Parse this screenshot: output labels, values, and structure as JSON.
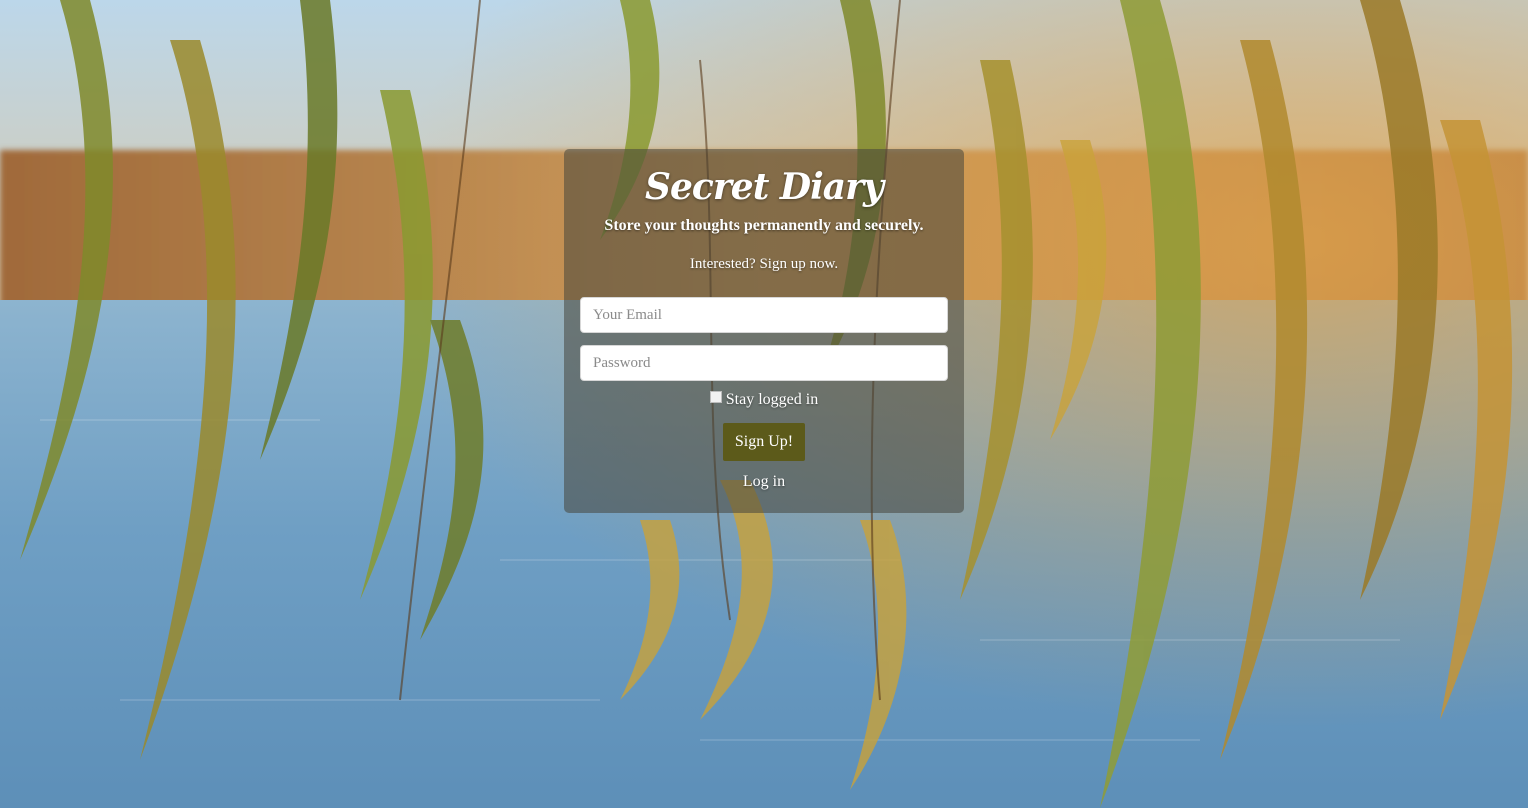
{
  "brand": {
    "title": "Secret Diary",
    "tagline": "Store your thoughts permanently and securely."
  },
  "form": {
    "prompt": "Interested? Sign up now.",
    "email_placeholder": "Your Email",
    "password_placeholder": "Password",
    "stay_logged_in_label": "Stay logged in",
    "stay_logged_in_checked": false,
    "submit_label": "Sign Up!",
    "toggle_link_label": "Log in"
  },
  "theme": {
    "panel_overlay": "#46463c",
    "button_color": "#5c5a1a",
    "text_color": "#ffffff"
  }
}
